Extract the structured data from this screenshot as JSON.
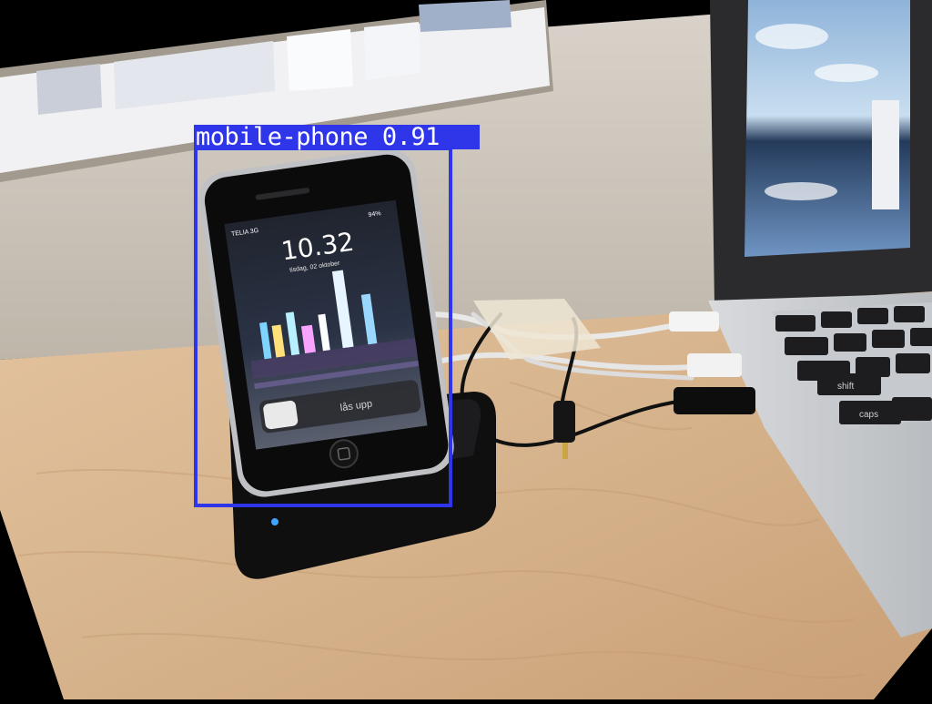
{
  "detection": {
    "class_label": "mobile-phone",
    "confidence": "0.91",
    "box_color": "#2f35e8"
  },
  "phone_screen": {
    "carrier": "TELIA 3G",
    "battery": "94%",
    "time": "10.32",
    "date": "tisdag, 02 oktober",
    "unlock_text": "lås upp"
  },
  "laptop_keys": [
    "shift",
    "caps"
  ]
}
